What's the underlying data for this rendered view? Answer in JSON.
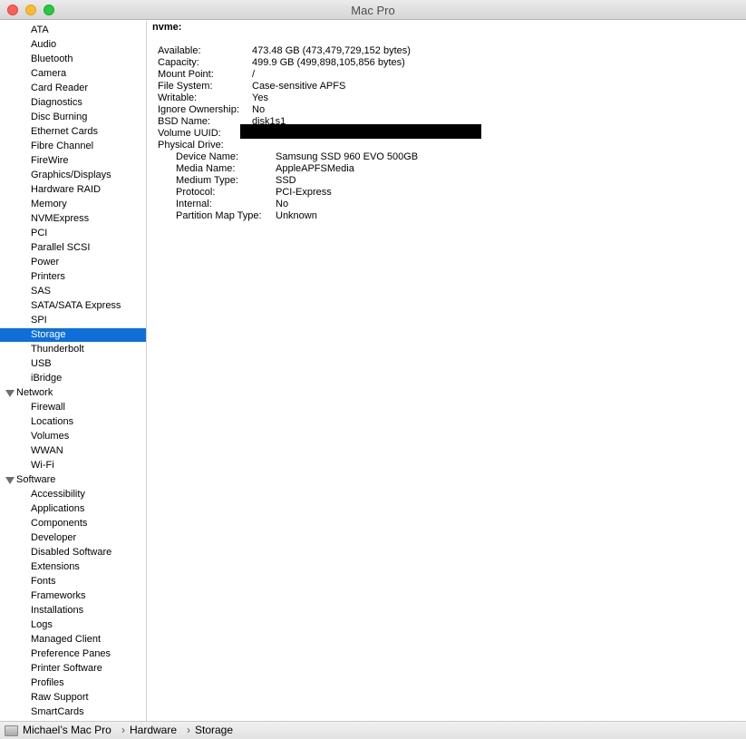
{
  "window": {
    "title": "Mac Pro"
  },
  "sidebar": {
    "hardware_items": [
      "ATA",
      "Audio",
      "Bluetooth",
      "Camera",
      "Card Reader",
      "Diagnostics",
      "Disc Burning",
      "Ethernet Cards",
      "Fibre Channel",
      "FireWire",
      "Graphics/Displays",
      "Hardware RAID",
      "Memory",
      "NVMExpress",
      "PCI",
      "Parallel SCSI",
      "Power",
      "Printers",
      "SAS",
      "SATA/SATA Express",
      "SPI",
      "Storage",
      "Thunderbolt",
      "USB",
      "iBridge"
    ],
    "selected": "Storage",
    "network_label": "Network",
    "network_items": [
      "Firewall",
      "Locations",
      "Volumes",
      "WWAN",
      "Wi-Fi"
    ],
    "software_label": "Software",
    "software_items": [
      "Accessibility",
      "Applications",
      "Components",
      "Developer",
      "Disabled Software",
      "Extensions",
      "Fonts",
      "Frameworks",
      "Installations",
      "Logs",
      "Managed Client",
      "Preference Panes",
      "Printer Software",
      "Profiles",
      "Raw Support",
      "SmartCards"
    ]
  },
  "content": {
    "title": "nvme:",
    "properties": [
      {
        "key": "Available:",
        "value": "473.48 GB (473,479,729,152 bytes)"
      },
      {
        "key": "Capacity:",
        "value": "499.9 GB (499,898,105,856 bytes)"
      },
      {
        "key": "Mount Point:",
        "value": "/"
      },
      {
        "key": "File System:",
        "value": "Case-sensitive APFS"
      },
      {
        "key": "Writable:",
        "value": "Yes"
      },
      {
        "key": "Ignore Ownership:",
        "value": "No"
      },
      {
        "key": "BSD Name:",
        "value": "disk1s1"
      },
      {
        "key": "Volume UUID:",
        "value": ""
      },
      {
        "key": "Physical Drive:",
        "value": ""
      }
    ],
    "drive_properties": [
      {
        "key": "Device Name:",
        "value": "Samsung SSD 960 EVO 500GB"
      },
      {
        "key": "Media Name:",
        "value": "AppleAPFSMedia"
      },
      {
        "key": "Medium Type:",
        "value": "SSD"
      },
      {
        "key": "Protocol:",
        "value": "PCI-Express"
      },
      {
        "key": "Internal:",
        "value": "No"
      },
      {
        "key": "Partition Map Type:",
        "value": "Unknown"
      }
    ]
  },
  "statusbar": {
    "crumbs": [
      "Michael’s Mac Pro",
      "Hardware",
      "Storage"
    ],
    "separator": "›"
  }
}
